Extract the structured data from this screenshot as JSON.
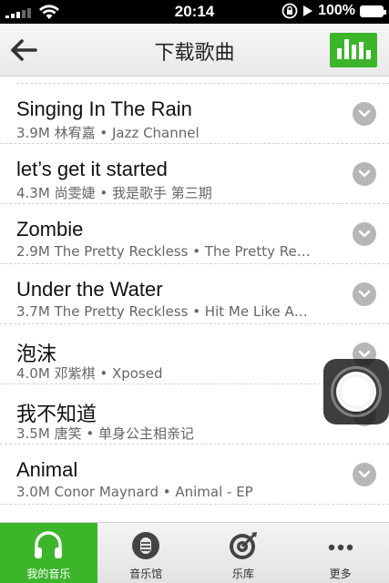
{
  "status_bar": {
    "time": "20:14",
    "battery": "100%"
  },
  "nav": {
    "title": "下载歌曲"
  },
  "songs": [
    {
      "title": "Singing In The Rain",
      "meta": "3.9M 林宥嘉 • Jazz Channel"
    },
    {
      "title": "let’s get it started",
      "meta": "4.3M 尚雯婕 • 我是歌手 第三期"
    },
    {
      "title": "Zombie",
      "meta": "2.9M The Pretty Reckless • The Pretty Re…"
    },
    {
      "title": "Under the Water",
      "meta": "3.7M The Pretty Reckless • Hit Me Like A…"
    },
    {
      "title": "泡沫",
      "meta": "4.0M 邓紫棋 • Xposed"
    },
    {
      "title": "我不知道",
      "meta": "3.5M 唐笑 • 单身公主相亲记"
    },
    {
      "title": "Animal",
      "meta": "3.0M Conor Maynard • Animal - EP"
    }
  ],
  "tabs": [
    {
      "label": "我的音乐",
      "icon": "headphones-icon",
      "active": true
    },
    {
      "label": "音乐馆",
      "icon": "music-hall-icon",
      "active": false
    },
    {
      "label": "乐库",
      "icon": "target-icon",
      "active": false
    },
    {
      "label": "更多",
      "icon": "more-dots-icon",
      "active": false
    }
  ],
  "colors": {
    "accent": "#3cb52b",
    "chevron": "#b6b6b6"
  }
}
